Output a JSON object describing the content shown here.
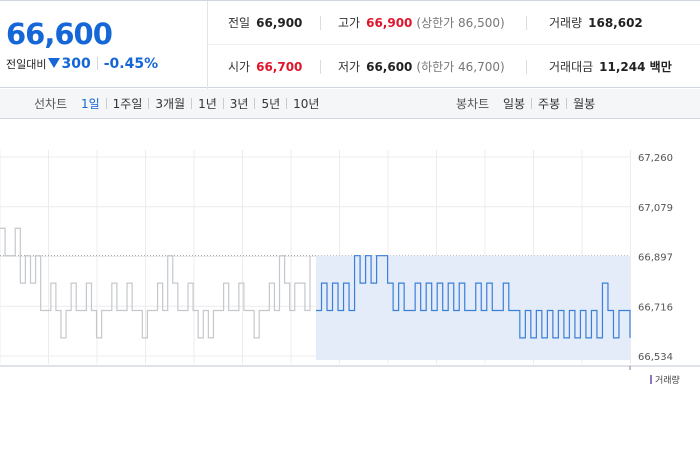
{
  "quote": {
    "current_price": "66,600",
    "compare_label": "전일대비",
    "change_value": "300",
    "change_rate": "-0.45%",
    "row1": [
      {
        "label": "전일",
        "value": "66,900",
        "color": "",
        "sub": ""
      },
      {
        "label": "고가",
        "value": "66,900",
        "color": "red",
        "sub": "(상한가 86,500)"
      },
      {
        "label": "거래량",
        "value": "168,602",
        "color": "",
        "sub": ""
      }
    ],
    "row2": [
      {
        "label": "시가",
        "value": "66,700",
        "color": "red",
        "sub": ""
      },
      {
        "label": "저가",
        "value": "66,600",
        "color": "",
        "sub": "(하한가 46,700)"
      },
      {
        "label": "거래대금",
        "value": "11,244 백만",
        "color": "",
        "sub": ""
      }
    ]
  },
  "tabs": {
    "line_chart_label": "선차트",
    "line_tabs": [
      "1일",
      "1주일",
      "3개월",
      "1년",
      "3년",
      "5년",
      "10년"
    ],
    "line_active": 0,
    "candle_chart_label": "봉차트",
    "candle_tabs": [
      "일봉",
      "주봉",
      "월봉"
    ]
  },
  "colors": {
    "price_down": "#1566d6",
    "price_up": "#e0142a",
    "today_line": "#3a7fd8",
    "today_fill": "#e4ecf9",
    "prev_line": "#c4c8cd"
  },
  "chart_data": {
    "type": "line",
    "yticks": [
      "67,260",
      "67,079",
      "66,897",
      "66,716",
      "66,534"
    ],
    "ylim": [
      66534,
      67260
    ],
    "prev_close": 66900,
    "series": [
      {
        "values": [
          67000,
          66900,
          66900,
          67000,
          66800,
          66900,
          66800,
          66900,
          66700,
          66700,
          66800,
          66700,
          66600,
          66700,
          66800,
          66700,
          66700,
          66800,
          66700,
          66600,
          66700,
          66700,
          66800,
          66700,
          66700,
          66800,
          66700,
          66700,
          66600,
          66700,
          66700,
          66800,
          66700,
          66900,
          66800,
          66700,
          66700,
          66800,
          66700,
          66600,
          66700,
          66600,
          66700,
          66700,
          66800,
          66700,
          66700,
          66800,
          66700,
          66700,
          66600,
          66700,
          66700,
          66800,
          66700,
          66900,
          66800,
          66700,
          66800,
          66800,
          66700,
          66900
        ]
      },
      {
        "values": [
          66700,
          66800,
          66700,
          66800,
          66700,
          66800,
          66700,
          66900,
          66800,
          66900,
          66800,
          66900,
          66900,
          66800,
          66700,
          66800,
          66700,
          66700,
          66800,
          66700,
          66800,
          66700,
          66800,
          66700,
          66800,
          66700,
          66800,
          66700,
          66700,
          66800,
          66700,
          66800,
          66700,
          66700,
          66800,
          66700,
          66700,
          66600,
          66700,
          66600,
          66700,
          66600,
          66700,
          66600,
          66700,
          66600,
          66700,
          66600,
          66700,
          66600,
          66700,
          66600,
          66800,
          66700,
          66600,
          66700,
          66700,
          66600
        ]
      }
    ],
    "legend": "거래량"
  }
}
